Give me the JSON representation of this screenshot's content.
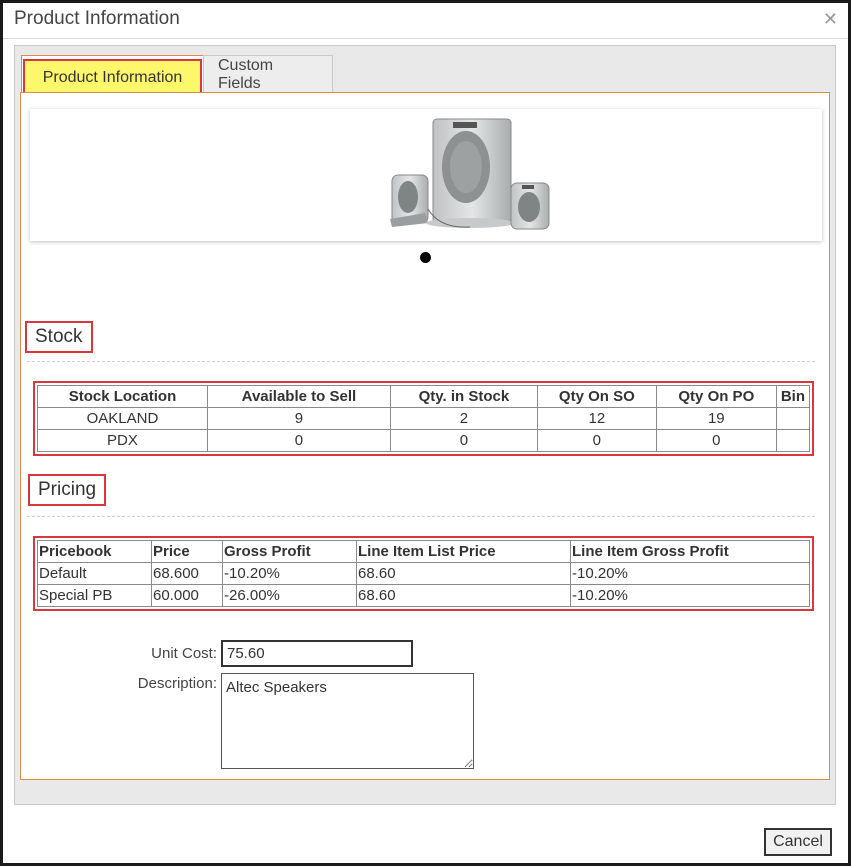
{
  "dialog": {
    "title": "Product Information",
    "close_icon": "close-icon"
  },
  "tabs": [
    {
      "label": "Product Information",
      "active": true
    },
    {
      "label": "Custom Fields",
      "active": false
    }
  ],
  "image": {
    "subject": "speaker system product photo"
  },
  "stock": {
    "title": "Stock",
    "headers": [
      "Stock Location",
      "Available to Sell",
      "Qty. in Stock",
      "Qty On SO",
      "Qty On PO",
      "Bin"
    ],
    "rows": [
      [
        "OAKLAND",
        "9",
        "2",
        "12",
        "19",
        ""
      ],
      [
        "PDX",
        "0",
        "0",
        "0",
        "0",
        ""
      ]
    ]
  },
  "pricing": {
    "title": "Pricing",
    "headers": [
      "Pricebook",
      "Price",
      "Gross Profit",
      "Line Item List Price",
      "Line Item Gross Profit"
    ],
    "rows": [
      [
        "Default",
        "68.600",
        "-10.20%",
        "68.60",
        "-10.20%"
      ],
      [
        "Special PB",
        "60.000",
        "-26.00%",
        "68.60",
        "-10.20%"
      ]
    ]
  },
  "form": {
    "unit_cost_label": "Unit Cost:",
    "unit_cost_value": "75.60",
    "description_label": "Description:",
    "description_value": "Altec Speakers"
  },
  "footer": {
    "cancel_label": "Cancel"
  },
  "colors": {
    "highlight_border": "#d9363e",
    "tab_highlight": "#fdf86b",
    "panel_border": "#e08a4a"
  }
}
